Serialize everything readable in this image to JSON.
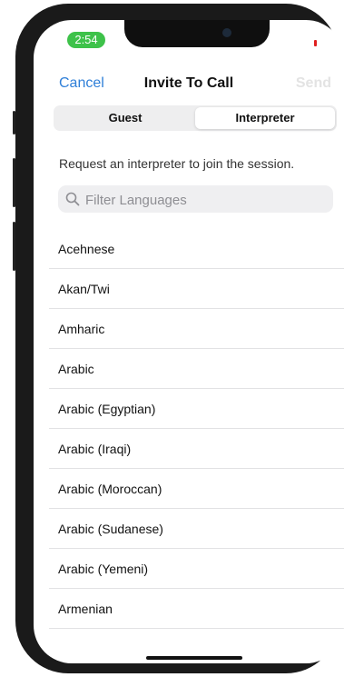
{
  "status_bar": {
    "time": "2:54"
  },
  "nav": {
    "cancel_label": "Cancel",
    "title": "Invite To Call",
    "send_label": "Send"
  },
  "segments": {
    "guest_label": "Guest",
    "interpreter_label": "Interpreter",
    "selected": "Interpreter"
  },
  "description": "Request an interpreter to join the session.",
  "search": {
    "placeholder": "Filter Languages",
    "value": ""
  },
  "languages": [
    "Acehnese",
    "Akan/Twi",
    "Amharic",
    "Arabic",
    "Arabic (Egyptian)",
    "Arabic (Iraqi)",
    "Arabic (Moroccan)",
    "Arabic (Sudanese)",
    "Arabic (Yemeni)",
    "Armenian"
  ],
  "colors": {
    "accent": "#2f7fd8",
    "status_pill": "#3ec24a",
    "disabled": "#e3e3e3"
  },
  "icons": {
    "search": "magnifying-glass"
  }
}
